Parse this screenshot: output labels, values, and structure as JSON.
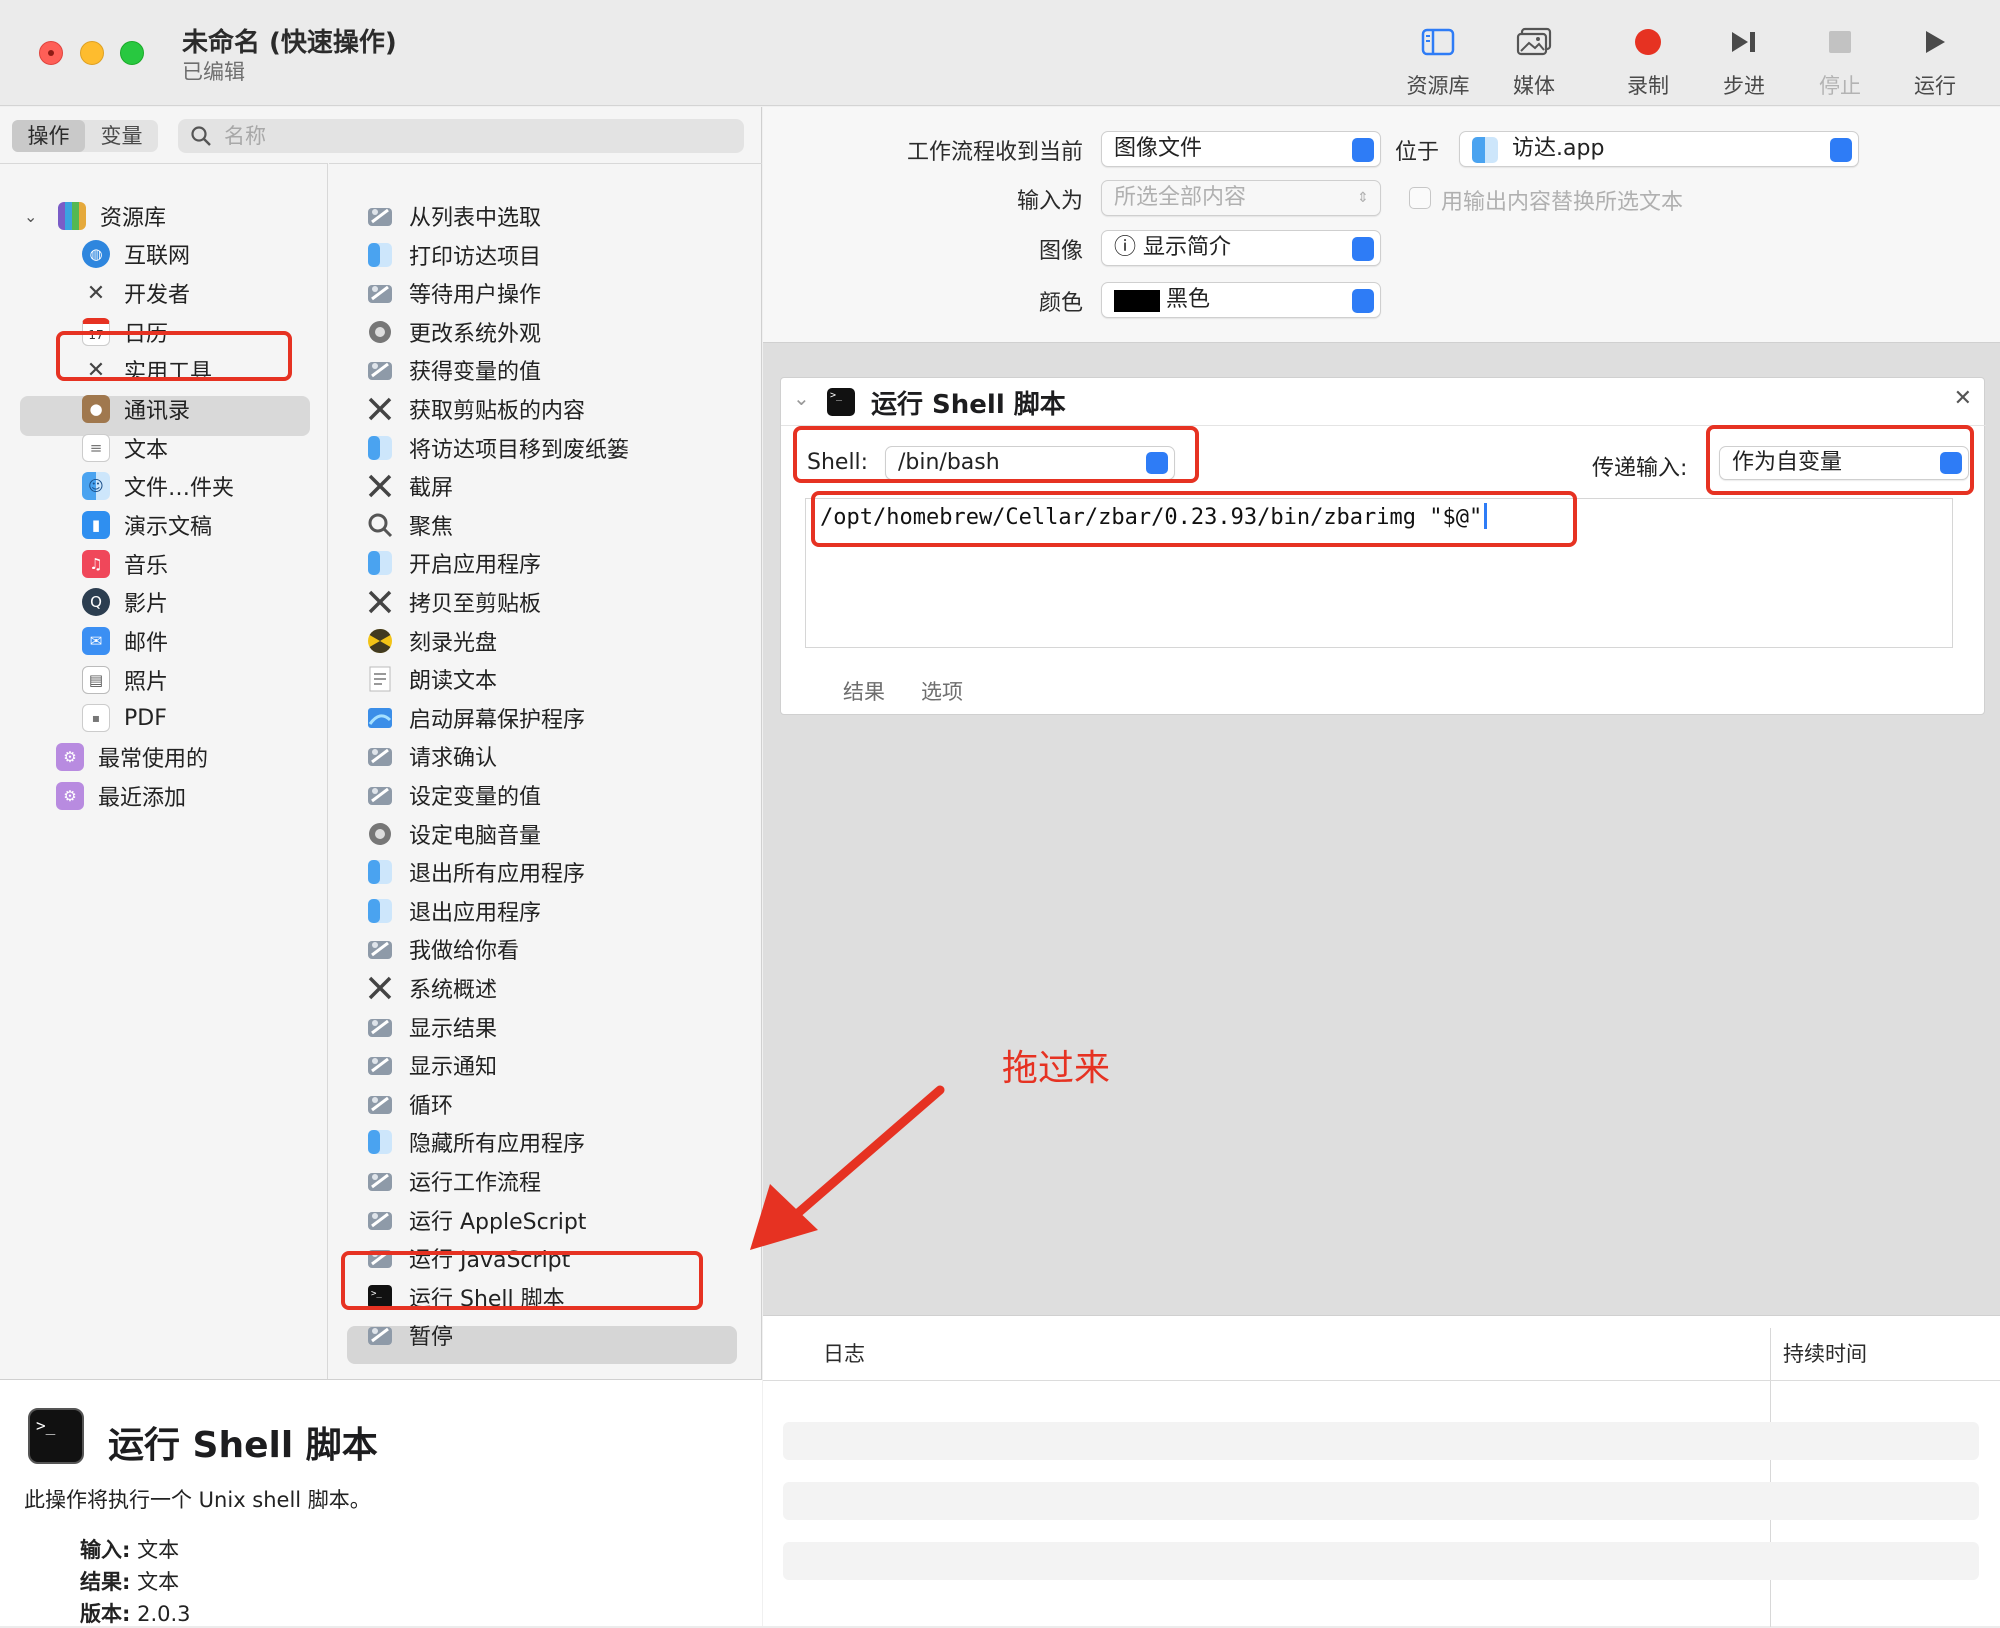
{
  "window": {
    "title": "未命名 (快速操作)",
    "subtitle": "已编辑"
  },
  "toolbar": {
    "buttons": [
      {
        "label": "资源库",
        "icon": "sidebar-icon"
      },
      {
        "label": "媒体",
        "icon": "photos-icon"
      },
      {
        "label": "录制",
        "icon": "record-icon"
      },
      {
        "label": "步进",
        "icon": "step-icon"
      },
      {
        "label": "停止",
        "icon": "stop-icon"
      },
      {
        "label": "运行",
        "icon": "play-icon"
      }
    ]
  },
  "sidebar": {
    "tabs": [
      "操作",
      "变量"
    ],
    "search_placeholder": "名称",
    "categories": [
      {
        "label": "资源库",
        "icon": "library-icon"
      },
      {
        "label": "互联网",
        "icon": "globe-icon"
      },
      {
        "label": "开发者",
        "icon": "tools-icon"
      },
      {
        "label": "日历",
        "icon": "calendar-icon"
      },
      {
        "label": "实用工具",
        "icon": "tools-icon"
      },
      {
        "label": "通讯录",
        "icon": "contacts-icon"
      },
      {
        "label": "文本",
        "icon": "text-icon"
      },
      {
        "label": "文件…件夹",
        "icon": "finder-icon"
      },
      {
        "label": "演示文稿",
        "icon": "keynote-icon"
      },
      {
        "label": "音乐",
        "icon": "music-icon"
      },
      {
        "label": "影片",
        "icon": "quicktime-icon"
      },
      {
        "label": "邮件",
        "icon": "mail-icon"
      },
      {
        "label": "照片",
        "icon": "photos-icon"
      },
      {
        "label": "PDF",
        "icon": "pdf-icon"
      },
      {
        "label": "最常使用的",
        "icon": "smart-folder-icon"
      },
      {
        "label": "最近添加",
        "icon": "smart-folder-icon"
      }
    ],
    "actions": [
      "从列表中选取",
      "打印访达项目",
      "等待用户操作",
      "更改系统外观",
      "获得变量的值",
      "获取剪贴板的内容",
      "将访达项目移到废纸篓",
      "截屏",
      "聚焦",
      "开启应用程序",
      "拷贝至剪贴板",
      "刻录光盘",
      "朗读文本",
      "启动屏幕保护程序",
      "请求确认",
      "设定变量的值",
      "设定电脑音量",
      "退出所有应用程序",
      "退出应用程序",
      "我做给你看",
      "系统概述",
      "显示结果",
      "显示通知",
      "循环",
      "隐藏所有应用程序",
      "运行工作流程",
      "运行 AppleScript",
      "运行 JavaScript",
      "运行 Shell 脚本",
      "暂停"
    ]
  },
  "description": {
    "title": "运行 Shell 脚本",
    "text": "此操作将执行一个 Unix shell 脚本。",
    "input_key": "输入:",
    "input_val": "文本",
    "result_key": "结果:",
    "result_val": "文本",
    "version_key": "版本:",
    "version_val": "2.0.3"
  },
  "workflow_header": {
    "receives_label": "工作流程收到当前",
    "receives_value": "图像文件",
    "in_label": "位于",
    "in_value": "访达.app",
    "input_is_label": "输入为",
    "input_is_value": "所选全部内容",
    "replace_label": "用输出内容替换所选文本",
    "image_label": "图像",
    "image_value": "ⓘ 显示简介",
    "color_label": "颜色",
    "color_value": "黑色",
    "color_swatch": "#000000"
  },
  "shell_action": {
    "title": "运行 Shell 脚本",
    "shell_label": "Shell:",
    "shell_value": "/bin/bash",
    "pass_input_label": "传递输入:",
    "pass_input_value": "作为自变量",
    "script": "/opt/homebrew/Cellar/zbar/0.23.93/bin/zbarimg \"$@\"",
    "tabs": [
      "结果",
      "选项"
    ]
  },
  "log": {
    "col_log": "日志",
    "col_duration": "持续时间"
  },
  "annotation": {
    "text": "拖过来",
    "color": "#e63222"
  }
}
